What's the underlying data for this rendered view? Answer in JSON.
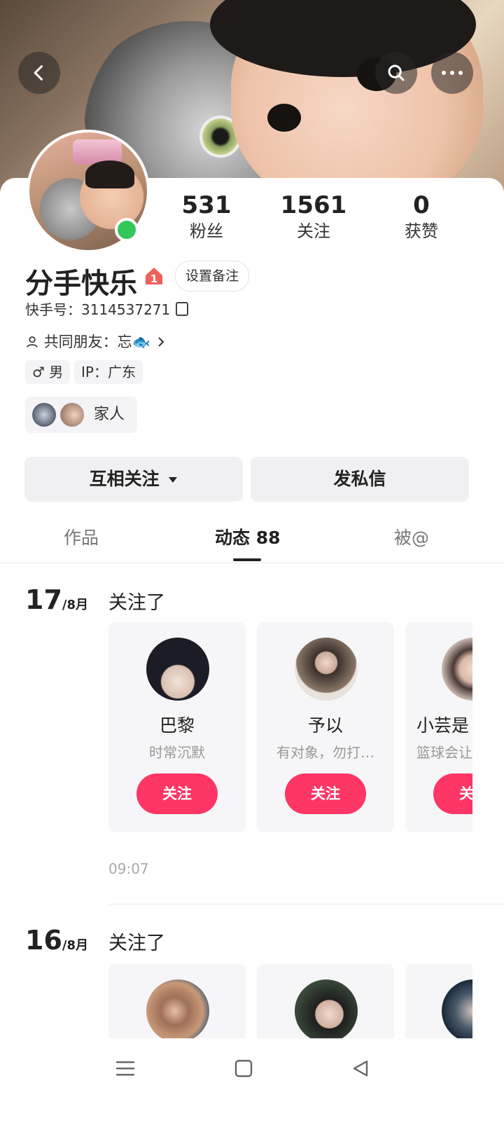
{
  "header": {
    "back_icon": "chevron-left-icon",
    "search_icon": "search-icon",
    "more_icon": "more-dots-icon"
  },
  "stats": [
    {
      "num": "531",
      "label": "粉丝"
    },
    {
      "num": "1561",
      "label": "关注"
    },
    {
      "num": "0",
      "label": "获赞"
    }
  ],
  "profile": {
    "name": "分手快乐",
    "badge": "1",
    "remark_button": "设置备注",
    "kuaishou_id": "快手号：3114537271",
    "mutual_friends": "共同朋友：忘🐟",
    "gender": "♂ 男",
    "ip": "IP：广东",
    "family_label": "家人"
  },
  "actions": {
    "follow_mutual": "互相关注",
    "message": "发私信"
  },
  "tabs": [
    {
      "label": "作品"
    },
    {
      "label": "动态 88"
    },
    {
      "label": "被@"
    }
  ],
  "feed": [
    {
      "day": "17",
      "month": "/8月",
      "action": "关注了",
      "time": "09:07",
      "cards": [
        {
          "name": "巴黎",
          "sub": "时常沉默",
          "button": "关注"
        },
        {
          "name": "予以",
          "sub": "有对象，勿打…",
          "button": "关注"
        },
        {
          "name": "小芸是",
          "sub": "篮球会让",
          "button": "关注"
        }
      ]
    },
    {
      "day": "16",
      "month": "/8月",
      "action": "关注了",
      "cards": []
    }
  ],
  "colors": {
    "accent": "#fe3666",
    "online": "#33c759"
  }
}
